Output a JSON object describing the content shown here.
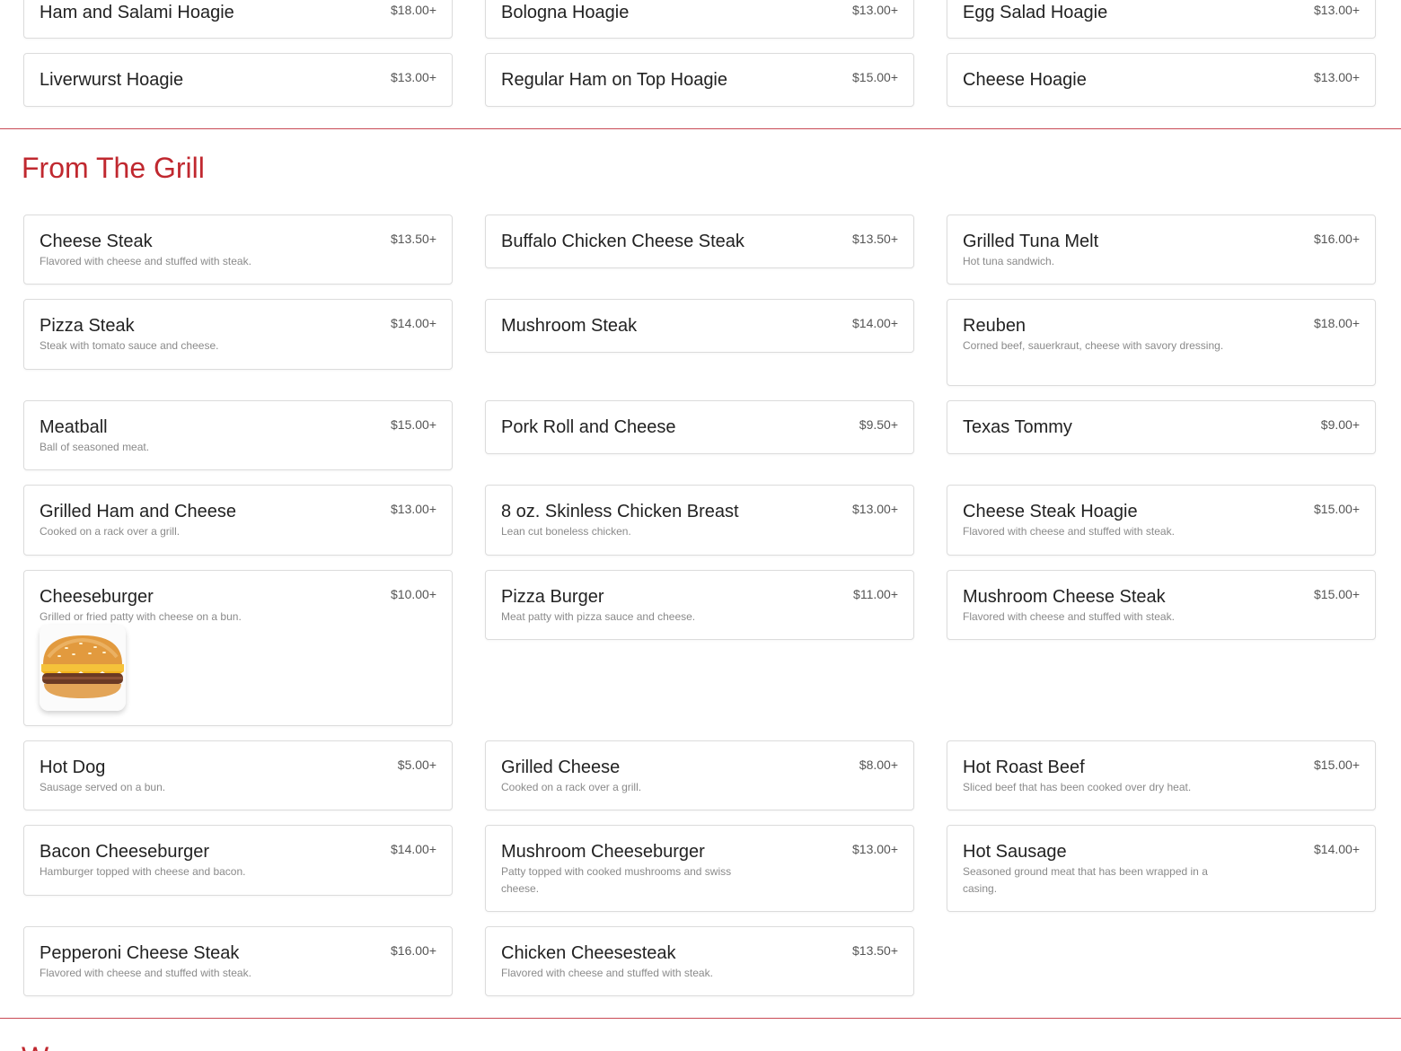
{
  "hoagies_tail": [
    {
      "name": "Ham and Salami Hoagie",
      "price": "$18.00+"
    },
    {
      "name": "Bologna Hoagie",
      "price": "$13.00+"
    },
    {
      "name": "Egg Salad Hoagie",
      "price": "$13.00+"
    },
    {
      "name": "Liverwurst Hoagie",
      "price": "$13.00+"
    },
    {
      "name": "Regular Ham on Top Hoagie",
      "price": "$15.00+"
    },
    {
      "name": "Cheese Hoagie",
      "price": "$13.00+"
    }
  ],
  "grill": {
    "title": "From The Grill",
    "items": [
      {
        "name": "Cheese Steak",
        "price": "$13.50+",
        "desc": "Flavored with cheese and stuffed with steak."
      },
      {
        "name": "Buffalo Chicken Cheese Steak",
        "price": "$13.50+",
        "desc": ""
      },
      {
        "name": "Grilled Tuna Melt",
        "price": "$16.00+",
        "desc": "Hot tuna sandwich."
      },
      {
        "name": "Pizza Steak",
        "price": "$14.00+",
        "desc": "Steak with tomato sauce and cheese."
      },
      {
        "name": "Mushroom Steak",
        "price": "$14.00+",
        "desc": ""
      },
      {
        "name": "Reuben",
        "price": "$18.00+",
        "desc": "Corned beef, sauerkraut, cheese with savory dressing."
      },
      {
        "name": "Meatball",
        "price": "$15.00+",
        "desc": "Ball of seasoned meat."
      },
      {
        "name": "Pork Roll and Cheese",
        "price": "$9.50+",
        "desc": ""
      },
      {
        "name": "Texas Tommy",
        "price": "$9.00+",
        "desc": ""
      },
      {
        "name": "Grilled Ham and Cheese",
        "price": "$13.00+",
        "desc": "Cooked on a rack over a grill."
      },
      {
        "name": "8 oz. Skinless Chicken Breast",
        "price": "$13.00+",
        "desc": "Lean cut boneless chicken."
      },
      {
        "name": "Cheese Steak Hoagie",
        "price": "$15.00+",
        "desc": "Flavored with cheese and stuffed with steak."
      },
      {
        "name": "Cheeseburger",
        "price": "$10.00+",
        "desc": "Grilled or fried patty with cheese on a bun."
      },
      {
        "name": "Pizza Burger",
        "price": "$11.00+",
        "desc": "Meat patty with pizza sauce and cheese."
      },
      {
        "name": "Mushroom Cheese Steak",
        "price": "$15.00+",
        "desc": "Flavored with cheese and stuffed with steak."
      },
      {
        "name": "Hot Dog",
        "price": "$5.00+",
        "desc": "Sausage served on a bun."
      },
      {
        "name": "Grilled Cheese",
        "price": "$8.00+",
        "desc": "Cooked on a rack over a grill."
      },
      {
        "name": "Hot Roast Beef",
        "price": "$15.00+",
        "desc": "Sliced beef that has been cooked over dry heat."
      },
      {
        "name": "Bacon Cheeseburger",
        "price": "$14.00+",
        "desc": "Hamburger topped with cheese and bacon."
      },
      {
        "name": "Mushroom Cheeseburger",
        "price": "$13.00+",
        "desc": "Patty topped with cooked mushrooms and swiss cheese."
      },
      {
        "name": "Hot Sausage",
        "price": "$14.00+",
        "desc": "Seasoned ground meat that has been wrapped in a casing."
      },
      {
        "name": "Pepperoni Cheese Steak",
        "price": "$16.00+",
        "desc": "Flavored with cheese and stuffed with steak."
      },
      {
        "name": "Chicken Cheesesteak",
        "price": "$13.50+",
        "desc": "Flavored with cheese and stuffed with steak."
      }
    ]
  },
  "wraps": {
    "title": "Wraps"
  },
  "colors": {
    "accent": "#c0282f",
    "divider": "#c94a55",
    "card_border": "#dcdcdc"
  }
}
